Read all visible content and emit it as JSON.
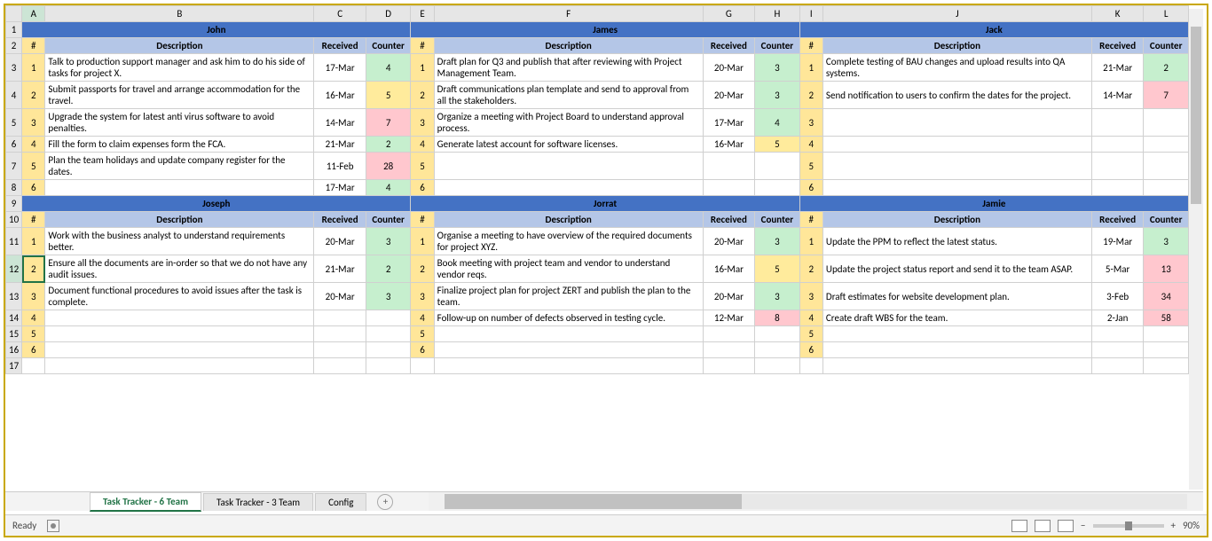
{
  "columns": [
    "A",
    "B",
    "C",
    "D",
    "E",
    "F",
    "G",
    "H",
    "I",
    "J",
    "K",
    "L"
  ],
  "rows": [
    "1",
    "2",
    "3",
    "4",
    "5",
    "6",
    "7",
    "8",
    "9",
    "10",
    "11",
    "12",
    "13",
    "14",
    "15",
    "16",
    "17"
  ],
  "headers": {
    "num": "#",
    "desc": "Description",
    "recv": "Received",
    "cnt": "Counter"
  },
  "selection": {
    "row": "12",
    "col": "A"
  },
  "people": [
    {
      "name": "John",
      "tasks": [
        {
          "n": "1",
          "d": "Talk to production support manager and ask him to do his side of tasks for project X.",
          "r": "17-Mar",
          "c": "4",
          "cls": "green"
        },
        {
          "n": "2",
          "d": "Submit passports for travel and arrange accommodation for the travel.",
          "r": "16-Mar",
          "c": "5",
          "cls": "yellow"
        },
        {
          "n": "3",
          "d": "Upgrade the system for latest anti virus software to avoid penalties.",
          "r": "14-Mar",
          "c": "7",
          "cls": "red"
        },
        {
          "n": "4",
          "d": "Fill the form to claim expenses form the FCA.",
          "r": "21-Mar",
          "c": "2",
          "cls": "green"
        },
        {
          "n": "5",
          "d": "Plan the team holidays and update company register for the dates.",
          "r": "11-Feb",
          "c": "28",
          "cls": "red"
        },
        {
          "n": "6",
          "d": "",
          "r": "17-Mar",
          "c": "4",
          "cls": "green"
        }
      ]
    },
    {
      "name": "James",
      "tasks": [
        {
          "n": "1",
          "d": "Draft plan for Q3 and publish that after reviewing with Project Management Team.",
          "r": "20-Mar",
          "c": "3",
          "cls": "green"
        },
        {
          "n": "2",
          "d": "Draft communications plan template and send to approval from all the stakeholders.",
          "r": "20-Mar",
          "c": "3",
          "cls": "green"
        },
        {
          "n": "3",
          "d": "Organize a meeting with Project Board to understand approval process.",
          "r": "17-Mar",
          "c": "4",
          "cls": "green"
        },
        {
          "n": "4",
          "d": "Generate latest account for software licenses.",
          "r": "16-Mar",
          "c": "5",
          "cls": "yellow"
        },
        {
          "n": "5",
          "d": "",
          "r": "",
          "c": "",
          "cls": "plain"
        },
        {
          "n": "6",
          "d": "",
          "r": "",
          "c": "",
          "cls": "plain"
        }
      ]
    },
    {
      "name": "Jack",
      "tasks": [
        {
          "n": "1",
          "d": "Complete testing of BAU changes and upload results into QA systems.",
          "r": "21-Mar",
          "c": "2",
          "cls": "green"
        },
        {
          "n": "2",
          "d": "Send notification to users to confirm the dates for the project.",
          "r": "14-Mar",
          "c": "7",
          "cls": "red"
        },
        {
          "n": "3",
          "d": "",
          "r": "",
          "c": "",
          "cls": "plain"
        },
        {
          "n": "4",
          "d": "",
          "r": "",
          "c": "",
          "cls": "plain"
        },
        {
          "n": "5",
          "d": "",
          "r": "",
          "c": "",
          "cls": "plain"
        },
        {
          "n": "6",
          "d": "",
          "r": "",
          "c": "",
          "cls": "plain"
        }
      ]
    },
    {
      "name": "Joseph",
      "tasks": [
        {
          "n": "1",
          "d": "Work with the business analyst to understand requirements better.",
          "r": "20-Mar",
          "c": "3",
          "cls": "green"
        },
        {
          "n": "2",
          "d": "Ensure all the documents are in-order so that we do not have any audit issues.",
          "r": "21-Mar",
          "c": "2",
          "cls": "green"
        },
        {
          "n": "3",
          "d": "Document functional procedures to avoid issues after the task is complete.",
          "r": "20-Mar",
          "c": "3",
          "cls": "green"
        },
        {
          "n": "4",
          "d": "",
          "r": "",
          "c": "",
          "cls": "plain"
        },
        {
          "n": "5",
          "d": "",
          "r": "",
          "c": "",
          "cls": "plain"
        },
        {
          "n": "6",
          "d": "",
          "r": "",
          "c": "",
          "cls": "plain"
        }
      ]
    },
    {
      "name": "Jorrat",
      "tasks": [
        {
          "n": "1",
          "d": "Organise a meeting to have overview of the required documents for project XYZ.",
          "r": "20-Mar",
          "c": "3",
          "cls": "green"
        },
        {
          "n": "2",
          "d": "Book meeting with project team and vendor to understand vendor reqs.",
          "r": "16-Mar",
          "c": "5",
          "cls": "yellow"
        },
        {
          "n": "3",
          "d": "Finalize project plan for project ZERT and publish the plan to the team.",
          "r": "20-Mar",
          "c": "3",
          "cls": "green"
        },
        {
          "n": "4",
          "d": "Follow-up on number of defects observed in testing cycle.",
          "r": "12-Mar",
          "c": "8",
          "cls": "red"
        },
        {
          "n": "5",
          "d": "",
          "r": "",
          "c": "",
          "cls": "plain"
        },
        {
          "n": "6",
          "d": "",
          "r": "",
          "c": "",
          "cls": "plain"
        }
      ]
    },
    {
      "name": "Jamie",
      "tasks": [
        {
          "n": "1",
          "d": "Update the PPM to reflect the latest status.",
          "r": "19-Mar",
          "c": "3",
          "cls": "green"
        },
        {
          "n": "2",
          "d": "Update the project status report and send it to the team ASAP.",
          "r": "5-Mar",
          "c": "13",
          "cls": "red"
        },
        {
          "n": "3",
          "d": "Draft estimates for website development plan.",
          "r": "3-Feb",
          "c": "34",
          "cls": "red"
        },
        {
          "n": "4",
          "d": "Create draft WBS for the team.",
          "r": "2-Jan",
          "c": "58",
          "cls": "red"
        },
        {
          "n": "5",
          "d": "",
          "r": "",
          "c": "",
          "cls": "plain"
        },
        {
          "n": "6",
          "d": "",
          "r": "",
          "c": "",
          "cls": "plain"
        }
      ]
    }
  ],
  "sheet_tabs": [
    {
      "label": "Task Tracker - 6 Team",
      "active": true
    },
    {
      "label": "Task Tracker - 3 Team",
      "active": false
    },
    {
      "label": "Config",
      "active": false
    }
  ],
  "status": {
    "ready": "Ready",
    "zoom": "90%"
  }
}
